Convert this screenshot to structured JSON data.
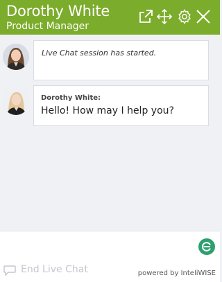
{
  "header": {
    "agent_name": "Dorothy White",
    "agent_role": "Product Manager",
    "icons": [
      "external-link-icon",
      "move-icon",
      "gear-icon",
      "close-icon"
    ],
    "background": "#7cac2b"
  },
  "messages": [
    {
      "type": "system",
      "text": "Live Chat session has started."
    },
    {
      "type": "agent",
      "sender": "Dorothy White:",
      "text": "Hello! How may I help you?"
    }
  ],
  "input": {
    "value": "",
    "placeholder": ""
  },
  "footer": {
    "end_chat_label": "End Live Chat",
    "powered_by": "powered by InteliWISE"
  }
}
